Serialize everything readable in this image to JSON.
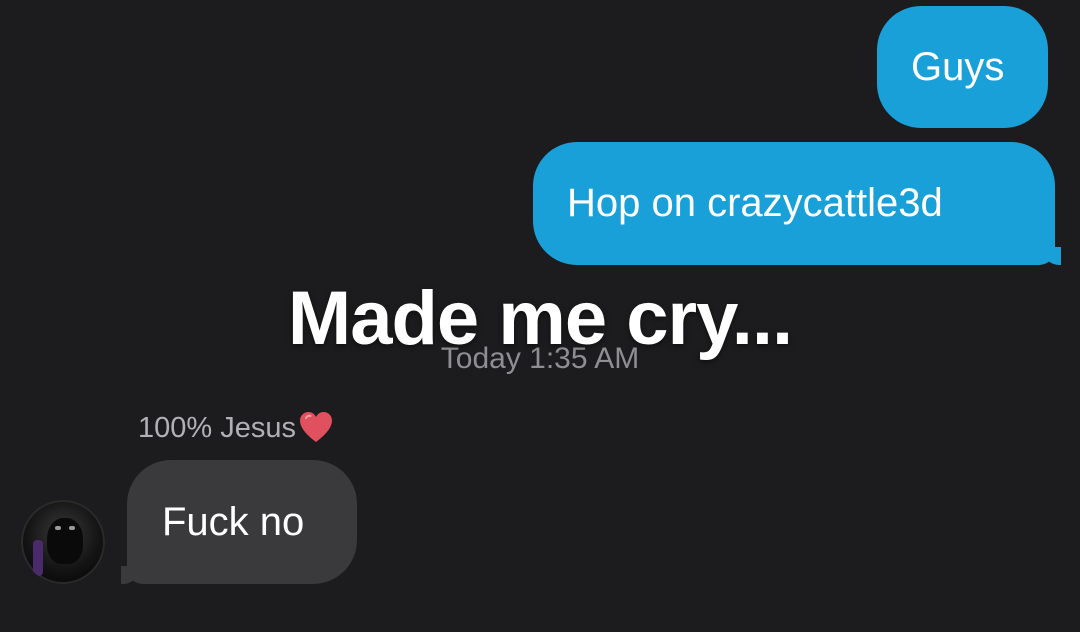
{
  "conversation": {
    "outgoing": [
      {
        "text": "Guys"
      },
      {
        "text": "Hop on crazycattle3d"
      }
    ],
    "overlay_caption": "Made me cry...",
    "timestamp": "Today 1:35 AM",
    "incoming": {
      "sender_name": "100% Jesus",
      "sender_emoji_icon": "red-heart-icon",
      "text": "Fuck no"
    }
  },
  "colors": {
    "background": "#1c1c1e",
    "outgoing_bubble": "#1aa0d8",
    "incoming_bubble": "#3a3a3c",
    "timestamp_text": "#8e8e93",
    "heart": "#e0505e"
  }
}
